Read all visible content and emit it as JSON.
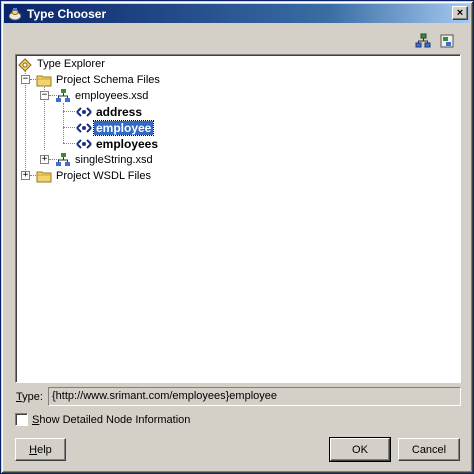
{
  "window": {
    "title": "Type Chooser",
    "close_glyph": "×"
  },
  "toolbar": {
    "icons": [
      "tree-expand-icon",
      "schema-refresh-icon"
    ]
  },
  "tree": {
    "root": "Type Explorer",
    "project_schema_files": "Project Schema Files",
    "employees_xsd": "employees.xsd",
    "address": "address",
    "employee": "employee",
    "employees": "employees",
    "single_string_xsd": "singleString.xsd",
    "project_wsdl_files": "Project WSDL Files",
    "selected": "employee",
    "expander_open": "−",
    "expander_closed": "+"
  },
  "type_field": {
    "label_mnemonic": "T",
    "label_rest": "ype:",
    "value": "{http://www.srimant.com/employees}employee"
  },
  "detail_checkbox": {
    "mnemonic": "S",
    "label_rest": "how Detailed Node Information",
    "checked": false
  },
  "buttons": {
    "help_mnemonic": "H",
    "help_rest": "elp",
    "ok": "OK",
    "cancel": "Cancel"
  },
  "colors": {
    "title_start": "#0a246a",
    "title_end": "#a6caf0",
    "selection": "#316ac5",
    "dialog_bg": "#d4d0c8"
  }
}
